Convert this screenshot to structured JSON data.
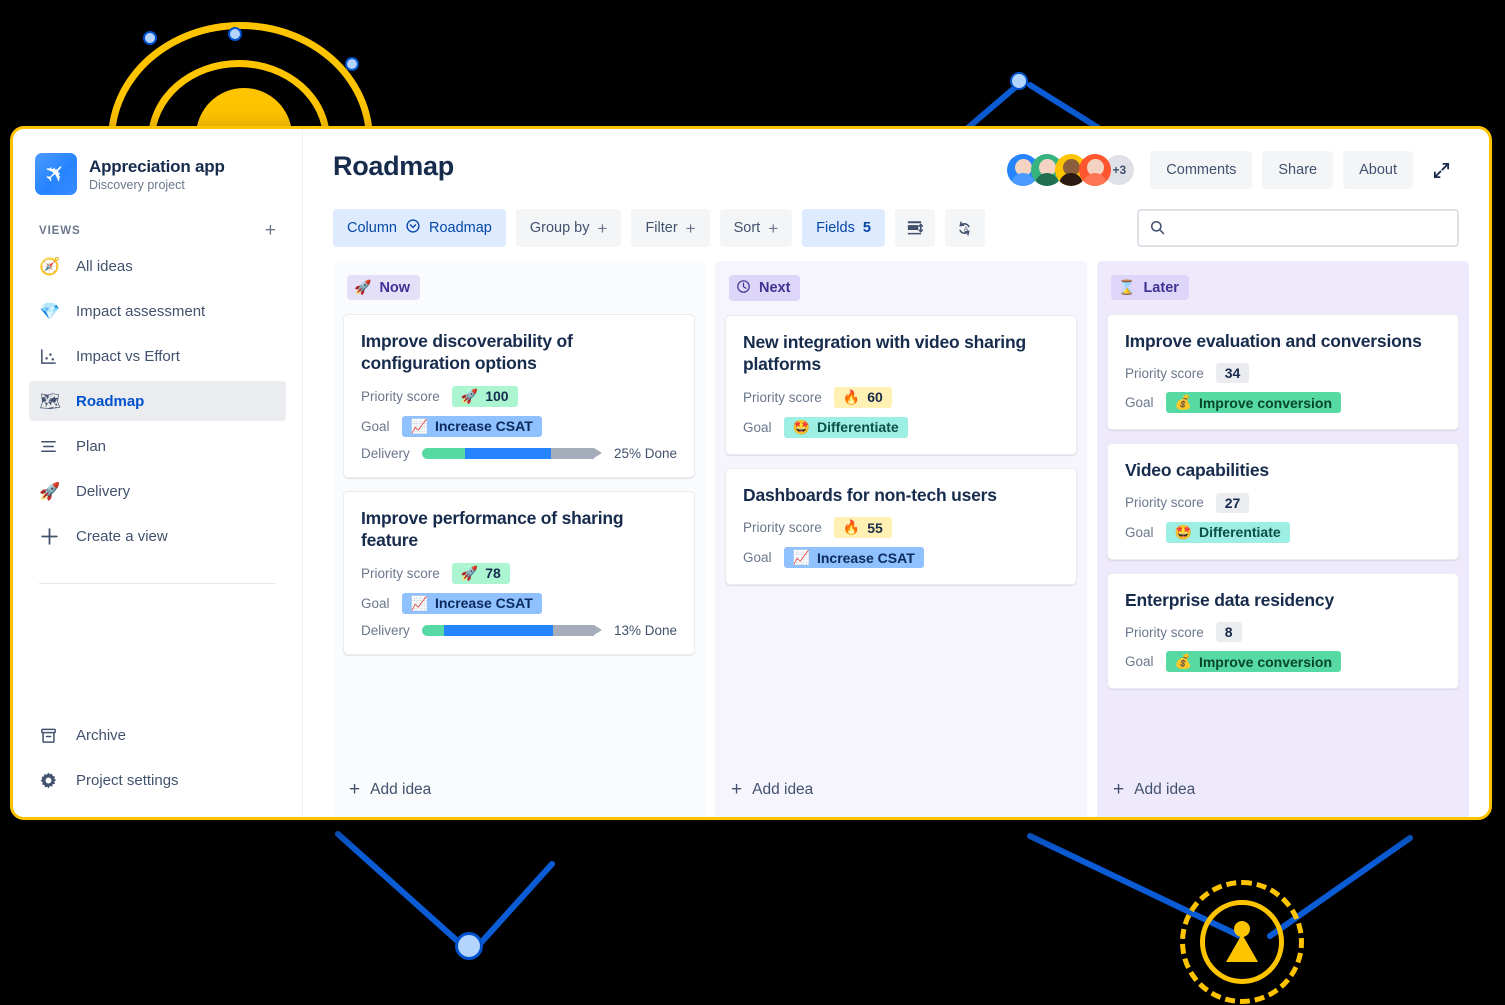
{
  "sidebar": {
    "project": {
      "name": "Appreciation app",
      "subtitle": "Discovery project",
      "avatar_icon": "rocket-plane-icon"
    },
    "views_label": "VIEWS",
    "add_view_icon": "plus-icon",
    "items": [
      {
        "label": "All ideas",
        "icon": "compass-icon",
        "emoji": "🧭",
        "active": false
      },
      {
        "label": "Impact assessment",
        "icon": "gem-icon",
        "emoji": "💎",
        "active": false
      },
      {
        "label": "Impact vs Effort",
        "icon": "scatter-chart-icon",
        "emoji": "",
        "active": false
      },
      {
        "label": "Roadmap",
        "icon": "map-icon",
        "emoji": "🗺️",
        "active": true
      },
      {
        "label": "Plan",
        "icon": "list-icon",
        "emoji": "",
        "active": false
      },
      {
        "label": "Delivery",
        "icon": "rocket-icon",
        "emoji": "🚀",
        "active": false
      },
      {
        "label": "Create a view",
        "icon": "plus-icon",
        "emoji": "",
        "active": false
      }
    ],
    "bottom_items": [
      {
        "label": "Archive",
        "icon": "archive-icon"
      },
      {
        "label": "Project settings",
        "icon": "gear-icon"
      }
    ]
  },
  "header": {
    "title": "Roadmap",
    "avatars": [
      {
        "ring": "#2684FF",
        "body": "#4C9AFF"
      },
      {
        "ring": "#36B37E",
        "body": "#57D9A3"
      },
      {
        "ring": "#FFC400",
        "body": "#4A3426"
      },
      {
        "ring": "#FF5630",
        "body": "#FF7452"
      }
    ],
    "avatar_overflow": "+3",
    "buttons": [
      {
        "label": "Comments",
        "name": "comments-button"
      },
      {
        "label": "Share",
        "name": "share-button"
      },
      {
        "label": "About",
        "name": "about-button"
      }
    ],
    "expand_icon": "expand-diagonal-icon"
  },
  "toolbar": {
    "column": {
      "label": "Column",
      "value": "Roadmap",
      "icon": "chevron-circle-down-icon"
    },
    "group_by": {
      "label": "Group by",
      "icon": "plus-icon"
    },
    "filter": {
      "label": "Filter",
      "icon": "plus-icon"
    },
    "sort": {
      "label": "Sort",
      "icon": "plus-icon"
    },
    "fields": {
      "label": "Fields",
      "count": "5"
    },
    "row_height_icon": "row-height-icon",
    "sync_icon": "sync-refresh-icon",
    "search": {
      "placeholder": "",
      "value": "",
      "icon": "search-icon"
    }
  },
  "board": {
    "add_idea_label": "Add idea",
    "priority_label": "Priority score",
    "goal_label": "Goal",
    "delivery_label": "Delivery",
    "columns": [
      {
        "name": "now",
        "title": "Now",
        "emoji": "🚀",
        "cards": [
          {
            "title": "Improve discoverability of configuration options",
            "priority": {
              "value": "100",
              "emoji": "🚀",
              "style": "pill-green"
            },
            "goal": {
              "label": "Increase CSAT",
              "emoji": "📈",
              "style": "goal-blue"
            },
            "delivery": {
              "text": "25% Done",
              "green_pct": 25,
              "blue_pct": 50,
              "grey_pct": 25
            }
          },
          {
            "title": "Improve performance of sharing feature",
            "priority": {
              "value": "78",
              "emoji": "🚀",
              "style": "pill-green"
            },
            "goal": {
              "label": "Increase CSAT",
              "emoji": "📈",
              "style": "goal-blue"
            },
            "delivery": {
              "text": "13% Done",
              "green_pct": 13,
              "blue_pct": 63,
              "grey_pct": 24
            }
          }
        ]
      },
      {
        "name": "next",
        "title": "Next",
        "emoji": "🕘",
        "cards": [
          {
            "title": "New integration with video sharing platforms",
            "priority": {
              "value": "60",
              "emoji": "🔥",
              "style": "pill-yellow"
            },
            "goal": {
              "label": "Differentiate",
              "emoji": "🤩",
              "style": "goal-teal"
            },
            "delivery": null
          },
          {
            "title": "Dashboards for non-tech users",
            "priority": {
              "value": "55",
              "emoji": "🔥",
              "style": "pill-yellow"
            },
            "goal": {
              "label": "Increase CSAT",
              "emoji": "📈",
              "style": "goal-blue"
            },
            "delivery": null
          }
        ]
      },
      {
        "name": "later",
        "title": "Later",
        "emoji": "⌛",
        "cards": [
          {
            "title": "Improve evaluation and conversions",
            "priority": {
              "value": "34",
              "emoji": "",
              "style": "pill-grey"
            },
            "goal": {
              "label": "Improve conversion",
              "emoji": "💰",
              "style": "goal-green"
            },
            "delivery": null
          },
          {
            "title": "Video capabilities",
            "priority": {
              "value": "27",
              "emoji": "",
              "style": "pill-grey"
            },
            "goal": {
              "label": "Differentiate",
              "emoji": "🤩",
              "style": "goal-teal"
            },
            "delivery": null
          },
          {
            "title": "Enterprise data residency",
            "priority": {
              "value": "8",
              "emoji": "",
              "style": "pill-grey"
            },
            "goal": {
              "label": "Improve conversion",
              "emoji": "💰",
              "style": "goal-green"
            },
            "delivery": null
          }
        ]
      }
    ]
  },
  "colors": {
    "accent_blue": "#0052CC",
    "frame_yellow": "#FFC400",
    "deco_blue": "#0B5CD5",
    "now_bg": "#FAFBFC",
    "next_bg": "#F6F5FE",
    "later_bg": "#EFEAFB"
  }
}
